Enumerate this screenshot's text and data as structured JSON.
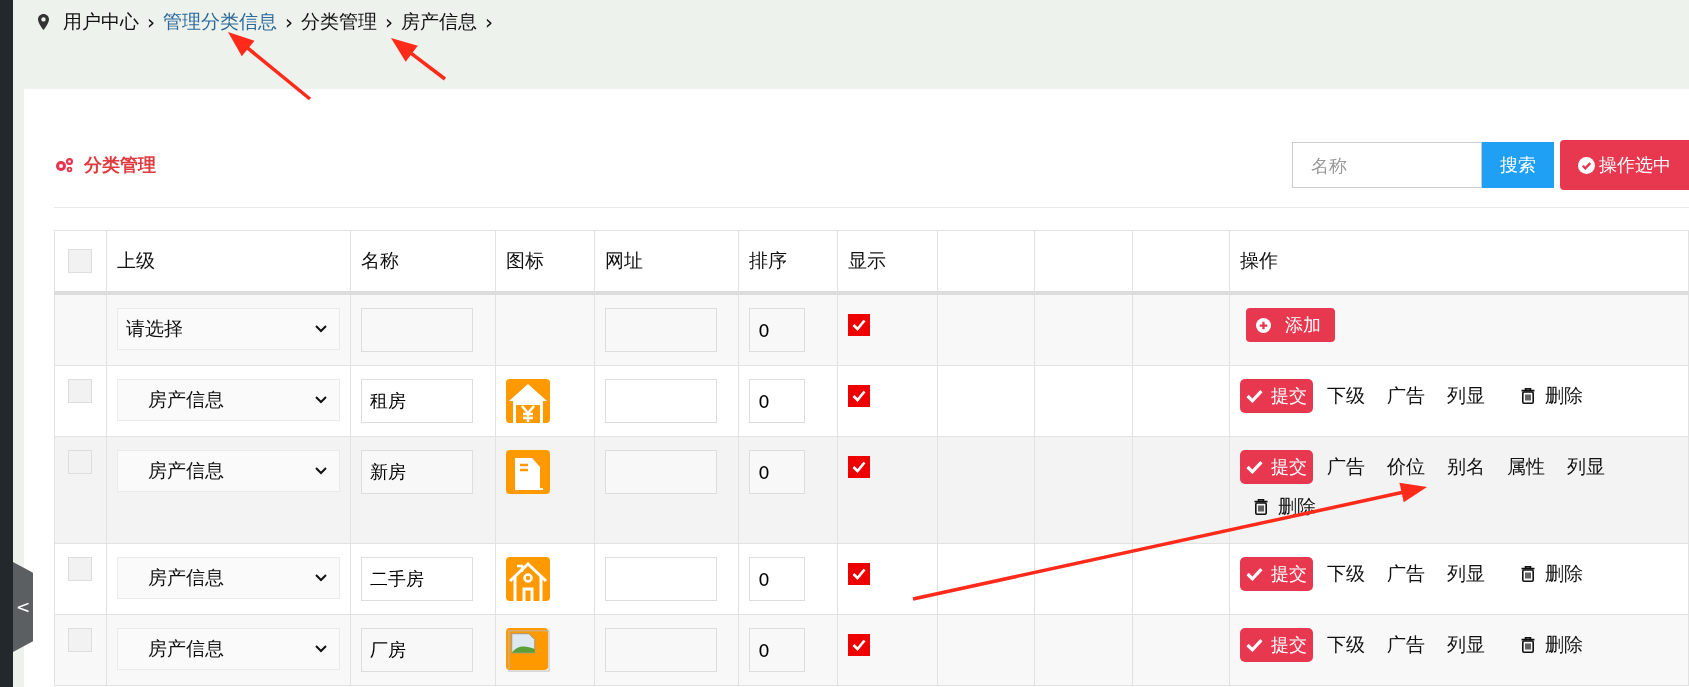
{
  "breadcrumb": [
    {
      "label": "用户中心",
      "kind": "text"
    },
    {
      "label": "管理分类信息",
      "kind": "link"
    },
    {
      "label": "分类管理",
      "kind": "text"
    },
    {
      "label": "房产信息",
      "kind": "text"
    }
  ],
  "breadcrumb_separator": "›",
  "sidebar_toggle": "<",
  "panel": {
    "title": "分类管理",
    "search": {
      "placeholder": "名称",
      "button": "搜索"
    },
    "bulk_button": "操作选中"
  },
  "table": {
    "columns": [
      "上级",
      "名称",
      "图标",
      "网址",
      "排序",
      "显示",
      "",
      "",
      "",
      "操作"
    ],
    "header_checkbox": {
      "checked": false
    },
    "rows": [
      {
        "kind": "new",
        "parent": "请选择",
        "name": "",
        "url": "",
        "sort": "0",
        "shown": true,
        "actions": [
          {
            "kind": "add",
            "label": "添加"
          }
        ]
      },
      {
        "kind": "item",
        "checked": false,
        "parent": "房产信息",
        "name": "租房",
        "url": "",
        "sort": "0",
        "shown": true,
        "actions": [
          {
            "kind": "submit",
            "label": "提交"
          },
          {
            "kind": "link",
            "label": "下级"
          },
          {
            "kind": "link",
            "label": "广告"
          },
          {
            "kind": "link",
            "label": "列显"
          },
          {
            "kind": "delete",
            "label": "删除"
          }
        ]
      },
      {
        "kind": "item",
        "checked": false,
        "parent": "房产信息",
        "name": "新房",
        "url": "",
        "sort": "0",
        "shown": true,
        "actions": [
          {
            "kind": "submit",
            "label": "提交"
          },
          {
            "kind": "link",
            "label": "广告"
          },
          {
            "kind": "link",
            "label": "价位"
          },
          {
            "kind": "link",
            "label": "别名"
          },
          {
            "kind": "link",
            "label": "属性"
          },
          {
            "kind": "link",
            "label": "列显"
          },
          {
            "kind": "delete",
            "label": "删除"
          }
        ]
      },
      {
        "kind": "item",
        "checked": false,
        "parent": "房产信息",
        "name": "二手房",
        "url": "",
        "sort": "0",
        "shown": true,
        "actions": [
          {
            "kind": "submit",
            "label": "提交"
          },
          {
            "kind": "link",
            "label": "下级"
          },
          {
            "kind": "link",
            "label": "广告"
          },
          {
            "kind": "link",
            "label": "列显"
          },
          {
            "kind": "delete",
            "label": "删除"
          }
        ]
      },
      {
        "kind": "item",
        "checked": false,
        "parent": "房产信息",
        "name": "厂房",
        "url": "",
        "sort": "0",
        "shown": true,
        "actions": [
          {
            "kind": "submit",
            "label": "提交"
          },
          {
            "kind": "link",
            "label": "下级"
          },
          {
            "kind": "link",
            "label": "广告"
          },
          {
            "kind": "link",
            "label": "列显"
          },
          {
            "kind": "delete",
            "label": "删除"
          }
        ]
      }
    ]
  },
  "annotation_arrows": [
    {
      "kind": "arrow"
    },
    {
      "kind": "arrow"
    },
    {
      "kind": "arrow"
    }
  ]
}
